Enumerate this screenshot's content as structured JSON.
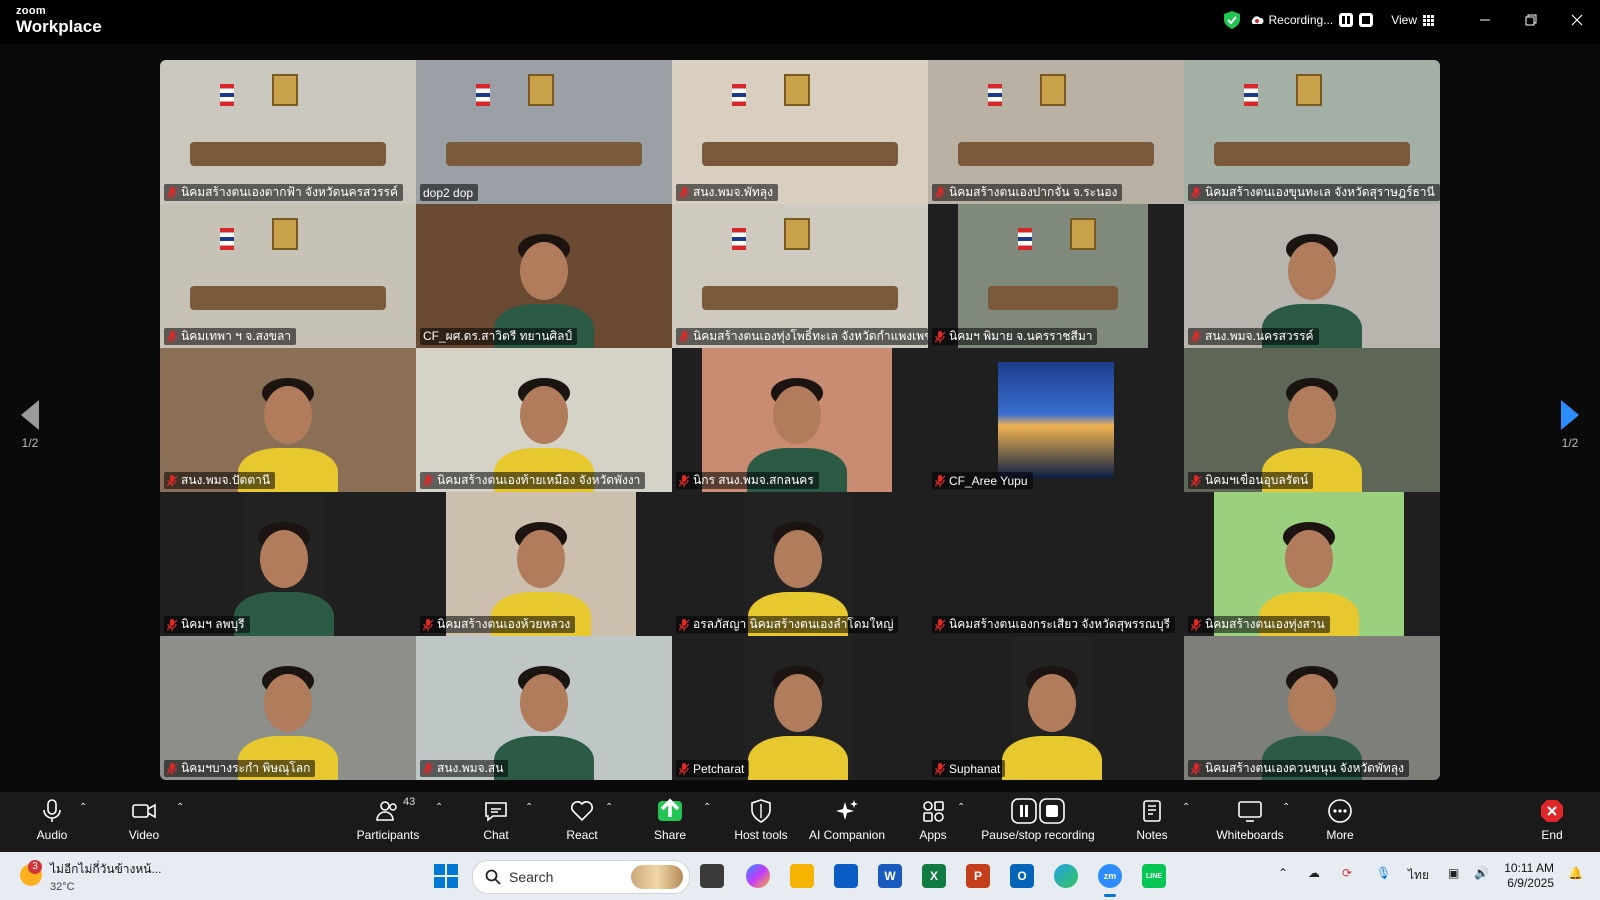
{
  "window": {
    "logo_line1": "zoom",
    "logo_line2": "Workplace",
    "recording_label": "Recording...",
    "view_label": "View"
  },
  "gallery": {
    "page_left": "1/2",
    "page_right": "1/2",
    "tiles": [
      {
        "name": "นิคมสร้างตนเองตากฟ้า จังหวัดนครสวรรค์",
        "muted": true,
        "scene": "room"
      },
      {
        "name": "dop2 dop",
        "muted": false,
        "scene": "room",
        "active": true
      },
      {
        "name": "สนง.พมจ.พัทลุง",
        "muted": true,
        "scene": "room"
      },
      {
        "name": "นิคมสร้างตนเองปากจั่น จ.ระนอง",
        "muted": true,
        "scene": "room"
      },
      {
        "name": "นิคมสร้างตนเองขุนทะเล จังหวัดสุราษฎร์ธานี",
        "muted": true,
        "scene": "room"
      },
      {
        "name": "นิคมเทพา ฯ จ.สงขลา",
        "muted": true,
        "scene": "room"
      },
      {
        "name": "CF_ผศ.ดร.สาวิตรี ทยานศิลป์",
        "muted": false,
        "scene": "person"
      },
      {
        "name": "นิคมสร้างตนเองทุ่งโพธิ์ทะเล จังหวัดกำแพงเพชร",
        "muted": true,
        "scene": "room"
      },
      {
        "name": "นิคมฯ พิมาย จ.นครราชสีมา",
        "muted": true,
        "scene": "room"
      },
      {
        "name": "สนง.พมจ.นครสวรรค์",
        "muted": true,
        "scene": "person"
      },
      {
        "name": "สนง.พมจ.ปัตตานี",
        "muted": true,
        "scene": "person"
      },
      {
        "name": "นิคมสร้างตนเองท้ายเหมือง จังหวัดพังงา",
        "muted": true,
        "scene": "person"
      },
      {
        "name": "นิกร สนง.พมจ.สกลนคร",
        "muted": true,
        "scene": "person"
      },
      {
        "name": "CF_Aree Yupu",
        "muted": true,
        "scene": "avatar"
      },
      {
        "name": "นิคมฯเขื่อนอุบลรัตน์",
        "muted": true,
        "scene": "person"
      },
      {
        "name": "นิคมฯ ลพบุรี",
        "muted": true,
        "scene": "person"
      },
      {
        "name": "นิคมสร้างตนเองห้วยหลวง",
        "muted": true,
        "scene": "person"
      },
      {
        "name": "อรลภัสญา นิคมสร้างตนเองลำโดมใหญ่",
        "muted": true,
        "scene": "person"
      },
      {
        "name": "นิคมสร้างตนเองกระเสียว จังหวัดสุพรรณบุรี",
        "muted": true,
        "scene": "empty"
      },
      {
        "name": "นิคมสร้างตนเองทุ่งสาน",
        "muted": true,
        "scene": "person"
      },
      {
        "name": "นิคมฯบางระกำ พิษณุโลก",
        "muted": true,
        "scene": "person"
      },
      {
        "name": "สนง.พมจ.สน",
        "muted": true,
        "scene": "person"
      },
      {
        "name": "Petcharat",
        "muted": true,
        "scene": "person"
      },
      {
        "name": "Suphanat",
        "muted": true,
        "scene": "person"
      },
      {
        "name": "นิคมสร้างตนเองควนขนุน จังหวัดพัทลุง",
        "muted": true,
        "scene": "person"
      }
    ]
  },
  "toolbar": {
    "audio": "Audio",
    "video": "Video",
    "participants": "Participants",
    "participants_count": "43",
    "chat": "Chat",
    "react": "React",
    "share": "Share",
    "host_tools": "Host tools",
    "ai_companion": "AI Companion",
    "apps": "Apps",
    "pause_stop": "Pause/stop recording",
    "notes": "Notes",
    "whiteboards": "Whiteboards",
    "more": "More",
    "end": "End"
  },
  "taskbar": {
    "weather_title": "ไม่อีกไม่กี่วันข้างหน้...",
    "weather_temp": "32°C",
    "weather_badge": "3",
    "search_placeholder": "Search",
    "lang": "ไทย",
    "time": "10:11 AM",
    "date": "6/9/2025",
    "colors": {
      "accent": "#0078d4",
      "zoom_blue": "#2d8cff",
      "end_red": "#e02828",
      "share_green": "#23c552"
    }
  }
}
